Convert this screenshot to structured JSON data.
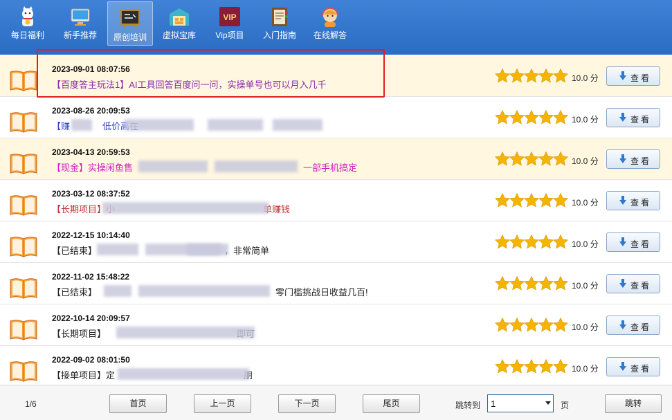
{
  "nav": [
    {
      "label": "每日福利",
      "icon": "lucky-cat-icon"
    },
    {
      "label": "新手推荐",
      "icon": "monitor-icon"
    },
    {
      "label": "原创培训",
      "icon": "blackboard-icon",
      "active": true
    },
    {
      "label": "虚拟宝库",
      "icon": "warehouse-icon"
    },
    {
      "label": "Vip项目",
      "icon": "vip-icon",
      "badge": "VIP"
    },
    {
      "label": "入门指南",
      "icon": "book-guide-icon"
    },
    {
      "label": "在线解答",
      "icon": "support-avatar-icon"
    }
  ],
  "rows": [
    {
      "date": "2023-09-01 08:07:56",
      "title": "【百度答主玩法1】AI工具回答百度问一问，实操单号也可以月入几千",
      "color": "#8b2bb0",
      "alt": true,
      "score": "10.0 分",
      "rating": 5
    },
    {
      "date": "2023-08-26 20:09:53",
      "title": "【赚",
      "title_tail": "低价高在",
      "color": "#2a3fd0",
      "alt": false,
      "score": "10.0 分",
      "rating": 5
    },
    {
      "date": "2023-04-13 20:59:53",
      "title": "【现金】实操闲鱼售",
      "title_tail": "一部手机搞定",
      "color": "#d020c0",
      "alt": true,
      "score": "10.0 分",
      "rating": 5
    },
    {
      "date": "2023-03-12 08:37:52",
      "title": "【长期项目】小",
      "title_tail": "单赚钱",
      "color": "#c03030",
      "alt": false,
      "score": "10.0 分",
      "rating": 5
    },
    {
      "date": "2022-12-15 10:14:40",
      "title": "【已结束】",
      "title_tail": "，非常简单",
      "color": "#222222",
      "alt": false,
      "score": "10.0 分",
      "rating": 5
    },
    {
      "date": "2022-11-02 15:48:22",
      "title": "【已结束】",
      "title_tail": "零门槛挑战日收益几百!",
      "color": "#222222",
      "alt": false,
      "score": "10.0 分",
      "rating": 5
    },
    {
      "date": "2022-10-14 20:09:57",
      "title": "【长期项目】",
      "title_tail": "即可",
      "color": "#222222",
      "alt": false,
      "score": "10.0 分",
      "rating": 5
    },
    {
      "date": "2022-09-02 08:01:50",
      "title": "【接单项目】定",
      "title_tail": "朋",
      "color": "#222222",
      "alt": false,
      "score": "10.0 分",
      "rating": 5
    }
  ],
  "view_label": "查看",
  "footer": {
    "page_info": "1/6",
    "first": "首页",
    "prev": "上一页",
    "next": "下一页",
    "last": "尾页",
    "jump_label": "跳转到",
    "page_select_value": "1",
    "page_unit": "页",
    "jump_button": "跳转"
  },
  "colors": {
    "nav_bg": "#3f82d6",
    "alt_row": "#fff7df",
    "star": "#f4b400",
    "highlight": "#e02020"
  }
}
